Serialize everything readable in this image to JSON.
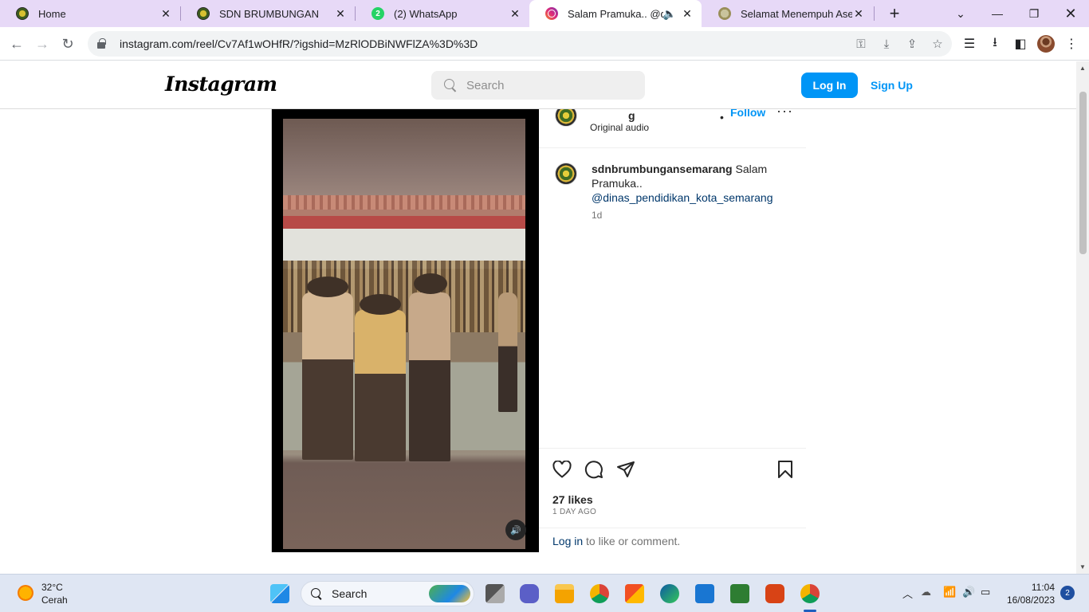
{
  "browser": {
    "tabs": [
      {
        "title": "Home",
        "icon": "scout-logo-icon"
      },
      {
        "title": "SDN BRUMBUNGAN",
        "icon": "scout-logo-icon"
      },
      {
        "title": "(2) WhatsApp",
        "icon": "whatsapp-icon",
        "badge": "2"
      },
      {
        "title": "Salam Pramuka.. @dinas",
        "icon": "instagram-icon",
        "active": true,
        "audio": true
      },
      {
        "title": "Selamat Menempuh Asesme",
        "icon": "site-logo-icon"
      }
    ],
    "url": "instagram.com/reel/Cv7Af1wOHfR/?igshid=MzRlODBiNWFlZA%3D%3D"
  },
  "instagram": {
    "logo": "Instagram",
    "search_placeholder": "Search",
    "login_label": "Log In",
    "signup_label": "Sign Up"
  },
  "post": {
    "account_name_visible": "g",
    "follow_label": "Follow",
    "audio_label": "Original audio",
    "caption_user": "sdnbrumbungansemarang",
    "caption_text": "Salam Pramuka..",
    "caption_mention": "@dinas_pendidikan_kota_semarang",
    "age": "1d",
    "likes": "27 likes",
    "posted": "1 DAY AGO",
    "login_link": "Log in",
    "login_suffix": "to like or comment."
  },
  "taskbar": {
    "temperature": "32°C",
    "condition": "Cerah",
    "search_label": "Search",
    "time": "11:04",
    "date": "16/08/2023",
    "notifications": "2"
  }
}
